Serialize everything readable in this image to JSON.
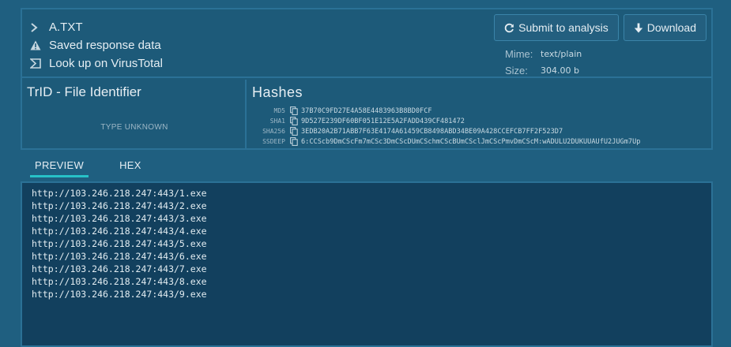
{
  "file": {
    "name": "A.TXT",
    "saved_label": "Saved response data",
    "virustotal_label": "Look up on VirusTotal"
  },
  "buttons": {
    "submit_label": "Submit to analysis",
    "download_label": "Download"
  },
  "meta": {
    "mime_label": "Mime:",
    "mime_value": "text/plain",
    "size_label": "Size:",
    "size_value": "304.00 b"
  },
  "trid": {
    "title": "TrID - File Identifier",
    "status": "TYPE UNKNOWN"
  },
  "hashes": {
    "title": "Hashes",
    "rows": [
      {
        "key": "MD5",
        "value": "37B70C9FD27E4A58E4483963B8BD0FCF"
      },
      {
        "key": "SHA1",
        "value": "9D527E239DF60BF051E12E5A2FADD439CF481472"
      },
      {
        "key": "SHA256",
        "value": "3EDB20A2B71ABB7F63E4174A61459CB8498ABD34BE09A428CCEFCB7FF2F523D7"
      },
      {
        "key": "SSDEEP",
        "value": "6:CCScb9DmCScFm7mCSc3DmCScDUmCSchmCScBUmCSclJmCScPmvDmCScM:wADULU2DUKUUAUfU2JUGm7Up"
      }
    ]
  },
  "tabs": [
    {
      "label": "PREVIEW",
      "active": true
    },
    {
      "label": "HEX",
      "active": false
    }
  ],
  "preview_lines": [
    "http://103.246.218.247:443/1.exe",
    "http://103.246.218.247:443/2.exe",
    "http://103.246.218.247:443/3.exe",
    "http://103.246.218.247:443/4.exe",
    "http://103.246.218.247:443/5.exe",
    "http://103.246.218.247:443/6.exe",
    "http://103.246.218.247:443/7.exe",
    "http://103.246.218.247:443/8.exe",
    "http://103.246.218.247:443/9.exe"
  ],
  "colors": {
    "background": "#1f5f80",
    "border": "#2b7196",
    "preview_bg": "#12405e",
    "tab_accent": "#27c2c8"
  }
}
